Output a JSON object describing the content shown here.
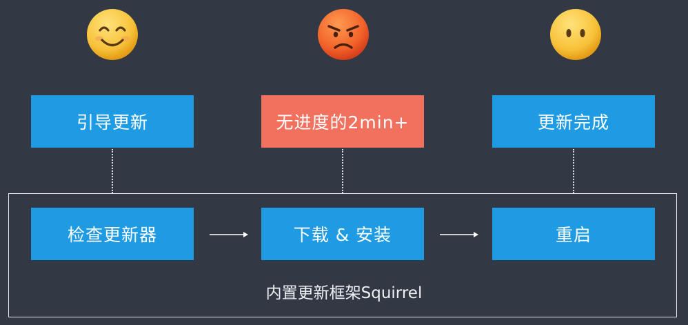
{
  "emojis": [
    {
      "icon": "smiling-face-icon"
    },
    {
      "icon": "angry-face-icon"
    },
    {
      "icon": "neutral-face-icon"
    }
  ],
  "user_experience": [
    {
      "label": "引导更新"
    },
    {
      "label": "无进度的2min+"
    },
    {
      "label": "更新完成"
    }
  ],
  "framework_steps": [
    {
      "label": "检查更新器"
    },
    {
      "label": "下载 & 安装"
    },
    {
      "label": "重启"
    }
  ],
  "framework_caption": "内置更新框架Squirrel",
  "colors": {
    "background": "#323945",
    "step_blue": "#1e9be3",
    "step_red": "#f2705e",
    "emoji_yellow": "#f7c940",
    "emoji_orange": "#f06a2c"
  }
}
